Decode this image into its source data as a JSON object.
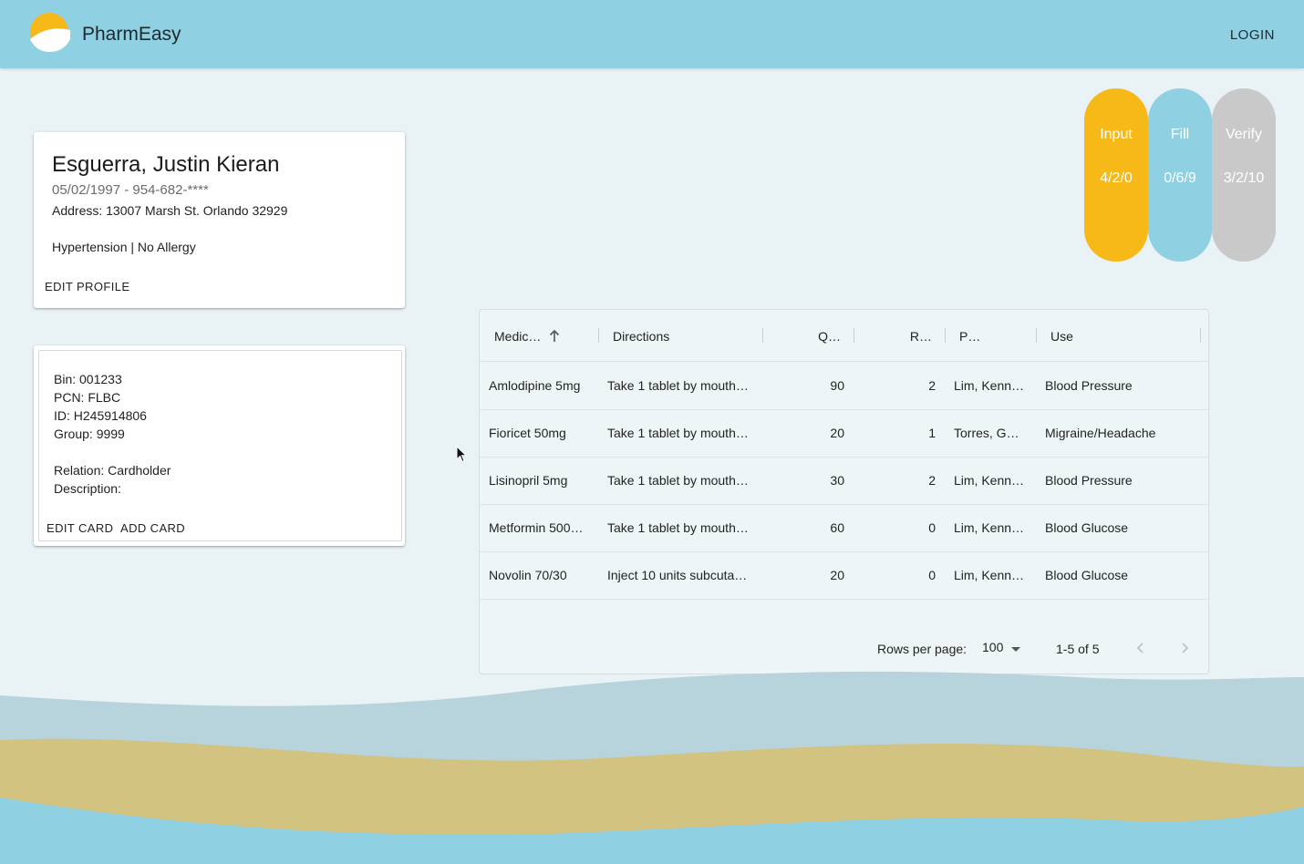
{
  "header": {
    "brand": "PharmEasy",
    "login": "LOGIN"
  },
  "profile": {
    "name": "Esguerra, Justin Kieran",
    "dob_phone": "05/02/1997 - 954-682-****",
    "address": "Address: 13007 Marsh St. Orlando 32929",
    "conditions": "Hypertension | No Allergy",
    "edit_label": "EDIT PROFILE"
  },
  "insurance": {
    "bin": "Bin: 001233",
    "pcn": "PCN: FLBC",
    "id": "ID: H245914806",
    "group": "Group: 9999",
    "relation": "Relation: Cardholder",
    "description": "Description:",
    "edit_label": "EDIT CARD",
    "add_label": "ADD CARD"
  },
  "status": [
    {
      "label": "Input",
      "count": "4/2/0",
      "color": "#f7b917"
    },
    {
      "label": "Fill",
      "count": "0/6/9",
      "color": "#8fd0e3"
    },
    {
      "label": "Verify",
      "count": "3/2/10",
      "color": "#c9c9c9"
    }
  ],
  "grid": {
    "columns": [
      "Medic…",
      "Directions",
      "Q…",
      "R…",
      "P…",
      "Use"
    ],
    "rows": [
      {
        "med": "Amlodipine 5mg",
        "dir": "Take 1 tablet by mouth…",
        "qty": "90",
        "ref": "2",
        "pres": "Lim, Kenn…",
        "use": "Blood Pressure"
      },
      {
        "med": "Fioricet 50mg",
        "dir": "Take 1 tablet by mouth…",
        "qty": "20",
        "ref": "1",
        "pres": "Torres, G…",
        "use": "Migraine/Headache"
      },
      {
        "med": "Lisinopril 5mg",
        "dir": "Take 1 tablet by mouth…",
        "qty": "30",
        "ref": "2",
        "pres": "Lim, Kenn…",
        "use": "Blood Pressure"
      },
      {
        "med": "Metformin 500…",
        "dir": "Take 1 tablet by mouth…",
        "qty": "60",
        "ref": "0",
        "pres": "Lim, Kenn…",
        "use": "Blood Glucose"
      },
      {
        "med": "Novolin 70/30",
        "dir": "Inject 10 units subcuta…",
        "qty": "20",
        "ref": "0",
        "pres": "Lim, Kenn…",
        "use": "Blood Glucose"
      }
    ],
    "rows_per_page_label": "Rows per page:",
    "rows_per_page": "100",
    "range": "1-5 of 5"
  }
}
